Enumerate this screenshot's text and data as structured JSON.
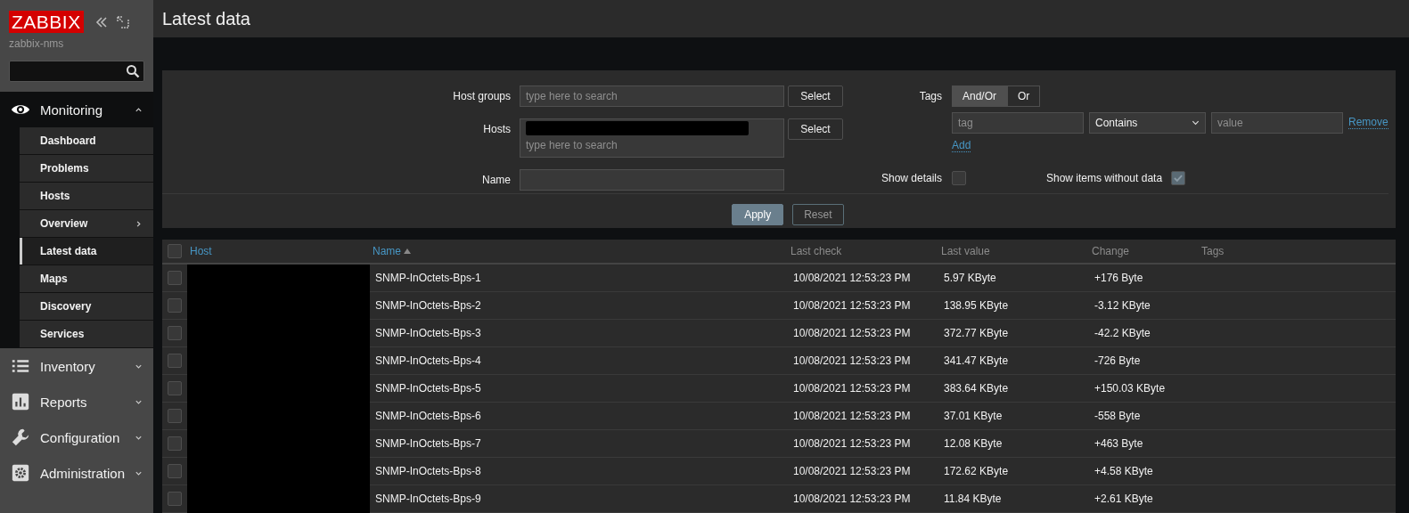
{
  "sidebar": {
    "logo": "ZABBIX",
    "server": "zabbix-nms",
    "menu": [
      {
        "label": "Monitoring",
        "expanded": true,
        "children": [
          {
            "label": "Dashboard",
            "selected": false,
            "submenu": false
          },
          {
            "label": "Problems",
            "selected": false,
            "submenu": false
          },
          {
            "label": "Hosts",
            "selected": false,
            "submenu": false
          },
          {
            "label": "Overview",
            "selected": false,
            "submenu": true
          },
          {
            "label": "Latest data",
            "selected": true,
            "submenu": false
          },
          {
            "label": "Maps",
            "selected": false,
            "submenu": false
          },
          {
            "label": "Discovery",
            "selected": false,
            "submenu": false
          },
          {
            "label": "Services",
            "selected": false,
            "submenu": false
          }
        ]
      },
      {
        "label": "Inventory",
        "expanded": false
      },
      {
        "label": "Reports",
        "expanded": false
      },
      {
        "label": "Configuration",
        "expanded": false
      },
      {
        "label": "Administration",
        "expanded": false
      }
    ]
  },
  "page_title": "Latest data",
  "filter": {
    "host_groups": {
      "label": "Host groups",
      "placeholder": "type here to search",
      "button": "Select"
    },
    "hosts": {
      "label": "Hosts",
      "placeholder": "type here to search",
      "button": "Select"
    },
    "name": {
      "label": "Name"
    },
    "tags": {
      "label": "Tags",
      "operators": [
        {
          "label": "And/Or",
          "selected": true
        },
        {
          "label": "Or",
          "selected": false
        }
      ],
      "rows": [
        {
          "tag_placeholder": "tag",
          "operator": "Contains",
          "value_placeholder": "value",
          "remove": "Remove"
        }
      ],
      "add": "Add"
    },
    "show_details": {
      "label": "Show details",
      "checked": false
    },
    "show_items_without_data": {
      "label": "Show items without data",
      "checked": true
    },
    "apply": "Apply",
    "reset": "Reset"
  },
  "table": {
    "select_all": {
      "checked": false
    },
    "columns": [
      {
        "label": "Host",
        "link": true,
        "sorted": false
      },
      {
        "label": "Name",
        "link": true,
        "sorted": true
      },
      {
        "label": "Last check",
        "link": false,
        "sorted": false
      },
      {
        "label": "Last value",
        "link": false,
        "sorted": false
      },
      {
        "label": "Change",
        "link": false,
        "sorted": false
      },
      {
        "label": "Tags",
        "link": false,
        "sorted": false
      }
    ],
    "rows": [
      {
        "checked": false,
        "name": "SNMP-InOctets-Bps-1",
        "last_check": "10/08/2021 12:53:23 PM",
        "last_value": "5.97 KByte",
        "change": "+176 Byte"
      },
      {
        "checked": false,
        "name": "SNMP-InOctets-Bps-2",
        "last_check": "10/08/2021 12:53:23 PM",
        "last_value": "138.95 KByte",
        "change": "-3.12 KByte"
      },
      {
        "checked": false,
        "name": "SNMP-InOctets-Bps-3",
        "last_check": "10/08/2021 12:53:23 PM",
        "last_value": "372.77 KByte",
        "change": "-42.2 KByte"
      },
      {
        "checked": false,
        "name": "SNMP-InOctets-Bps-4",
        "last_check": "10/08/2021 12:53:23 PM",
        "last_value": "341.47 KByte",
        "change": "-726 Byte"
      },
      {
        "checked": false,
        "name": "SNMP-InOctets-Bps-5",
        "last_check": "10/08/2021 12:53:23 PM",
        "last_value": "383.64 KByte",
        "change": "+150.03 KByte"
      },
      {
        "checked": false,
        "name": "SNMP-InOctets-Bps-6",
        "last_check": "10/08/2021 12:53:23 PM",
        "last_value": "37.01 KByte",
        "change": "-558 Byte"
      },
      {
        "checked": false,
        "name": "SNMP-InOctets-Bps-7",
        "last_check": "10/08/2021 12:53:23 PM",
        "last_value": "12.08 KByte",
        "change": "+463 Byte"
      },
      {
        "checked": false,
        "name": "SNMP-InOctets-Bps-8",
        "last_check": "10/08/2021 12:53:23 PM",
        "last_value": "172.62 KByte",
        "change": "+4.58 KByte"
      },
      {
        "checked": false,
        "name": "SNMP-InOctets-Bps-9",
        "last_check": "10/08/2021 12:53:23 PM",
        "last_value": "11.84 KByte",
        "change": "+2.61 KByte"
      }
    ]
  }
}
